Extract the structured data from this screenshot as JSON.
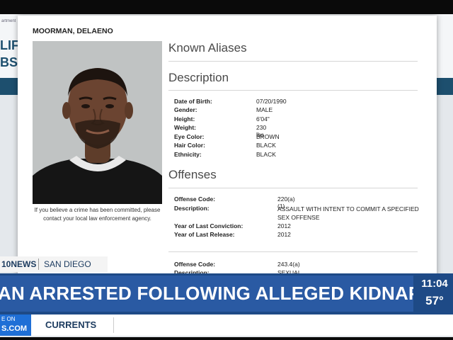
{
  "background_site": {
    "top_text": "artment",
    "line1": "LIFO",
    "line2": "BSE"
  },
  "profile": {
    "name": "MOORMAN, DELAENO",
    "photo_caption": "If you believe a crime has been committed, please contact your local law enforcement agency."
  },
  "sections": {
    "aliases": "Known Aliases",
    "description": "Description",
    "offenses": "Offenses"
  },
  "description": [
    {
      "label": "Date of Birth:",
      "value": "07/20/1990"
    },
    {
      "label": "Gender:",
      "value": "MALE"
    },
    {
      "label": "Height:",
      "value": "6'04\""
    },
    {
      "label": "Weight:",
      "value": "230 lbs"
    },
    {
      "label": "Eye Color:",
      "value": "BROWN"
    },
    {
      "label": "Hair Color:",
      "value": "BLACK"
    },
    {
      "label": "Ethnicity:",
      "value": "BLACK"
    }
  ],
  "offenses": [
    {
      "code_label": "Offense Code:",
      "code": "220(a)(1)",
      "desc_label": "Description:",
      "desc": "ASSAULT WITH INTENT TO COMMIT A SPECIFIED SEX OFFENSE",
      "conviction_label": "Year of Last Conviction:",
      "conviction": "2012",
      "release_label": "Year of Last Release:",
      "release": "2012"
    },
    {
      "code_label": "Offense Code:",
      "code": "243.4(a)",
      "desc_label": "Description:",
      "desc": "SEXUAL BATTERY"
    }
  ],
  "tv": {
    "station": "10NEWS",
    "city": "SAN DIEGO",
    "headline": "AN ARRESTED FOLLOWING ALLEGED KIDNAPPING",
    "time": "11:04",
    "temperature": "57°",
    "web_top": "E ON",
    "web_bottom": "S.COM",
    "ticker_label": "CURRENTS"
  },
  "colors": {
    "headline_bg": "#2a5aa3",
    "brand_blue": "#1d3c60",
    "site_bar": "#1d4f6e"
  }
}
